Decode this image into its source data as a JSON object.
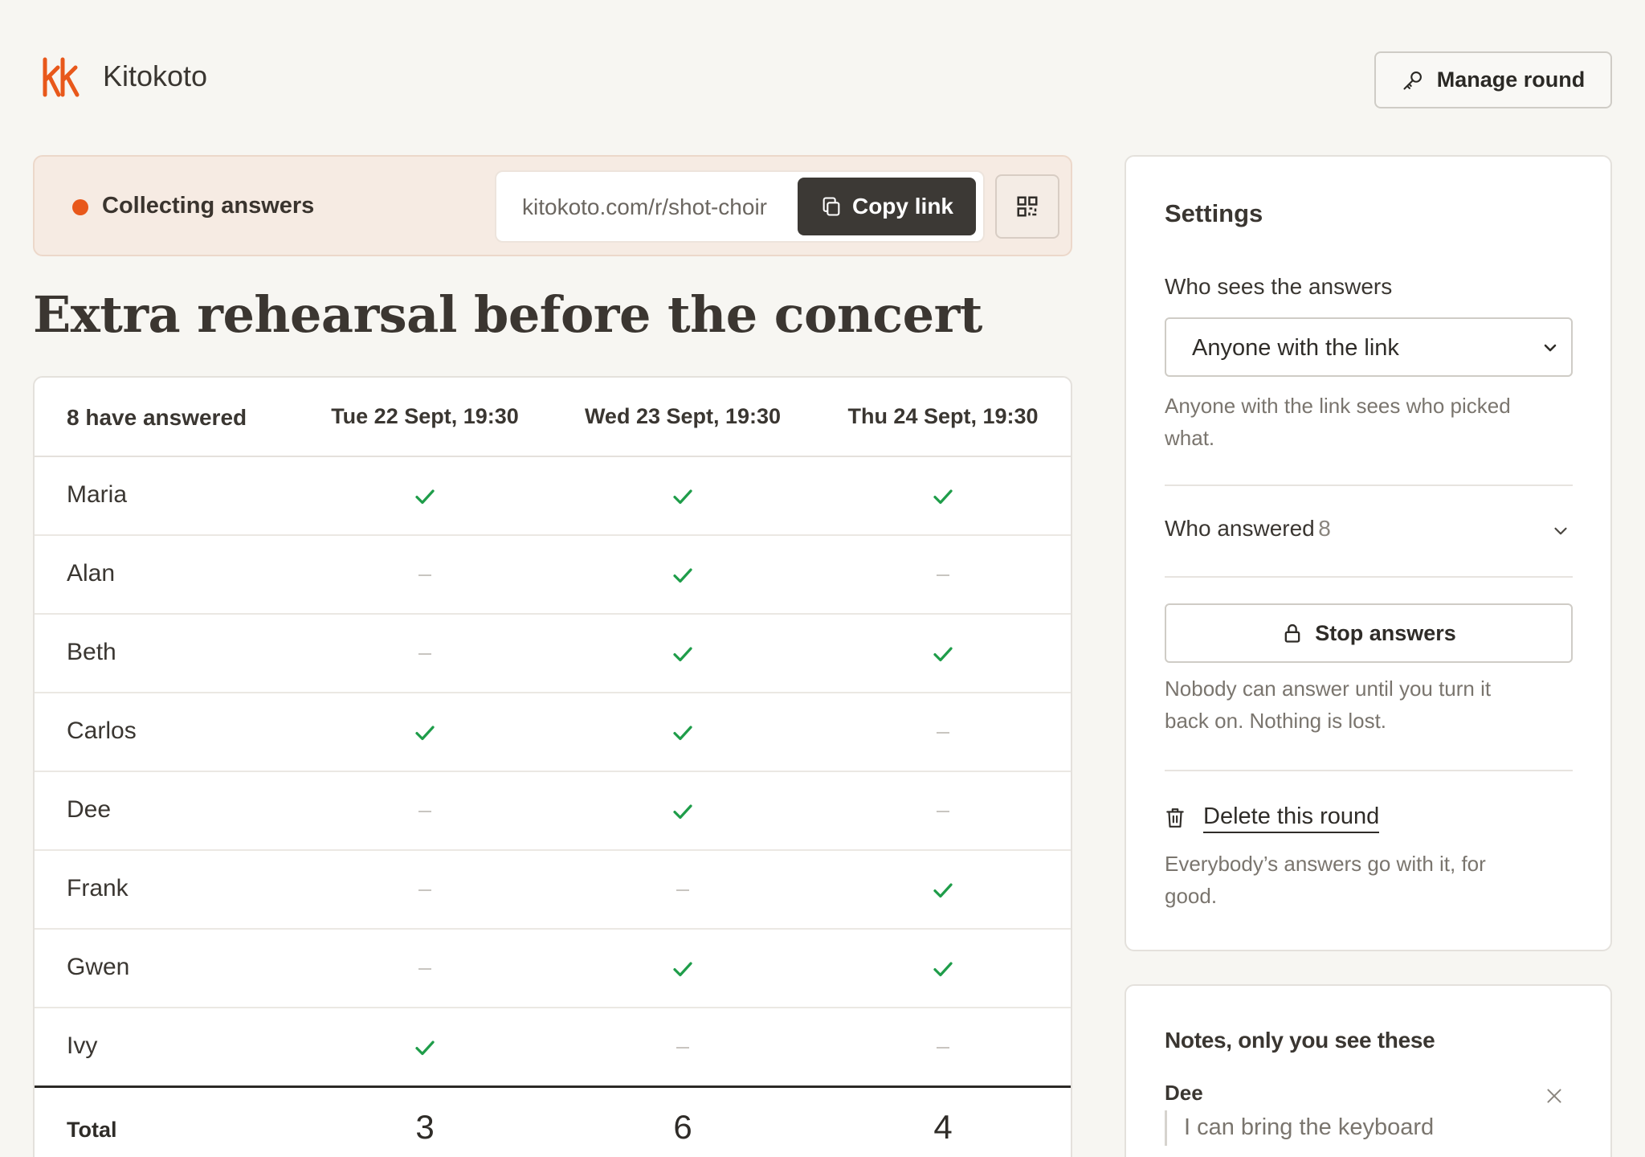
{
  "brand": {
    "name": "Kitokoto",
    "accent": "#e8581b"
  },
  "header": {
    "manage_label": "Manage round"
  },
  "status": {
    "text": "Collecting answers",
    "link": "kitokoto.com/r/shot-choir",
    "copy_label": "Copy link"
  },
  "title": "Extra rehearsal before the concert",
  "table": {
    "answered_label": "8 have answered",
    "columns": [
      "Tue 22 Sept, 19:30",
      "Wed 23 Sept, 19:30",
      "Thu 24 Sept, 19:30"
    ],
    "rows": [
      {
        "name": "Maria",
        "answers": [
          true,
          true,
          true
        ]
      },
      {
        "name": "Alan",
        "answers": [
          false,
          true,
          false
        ]
      },
      {
        "name": "Beth",
        "answers": [
          false,
          true,
          true
        ]
      },
      {
        "name": "Carlos",
        "answers": [
          true,
          true,
          false
        ]
      },
      {
        "name": "Dee",
        "answers": [
          false,
          true,
          false
        ]
      },
      {
        "name": "Frank",
        "answers": [
          false,
          false,
          true
        ]
      },
      {
        "name": "Gwen",
        "answers": [
          false,
          true,
          true
        ]
      },
      {
        "name": "Ivy",
        "answers": [
          true,
          false,
          false
        ]
      }
    ],
    "total_label": "Total",
    "totals": [
      "3",
      "6",
      "4"
    ]
  },
  "settings": {
    "title": "Settings",
    "visibility_label": "Who sees the answers",
    "visibility_value": "Anyone with the link",
    "visibility_help": "Anyone with the link sees who picked what.",
    "who_answered_label": "Who answered",
    "who_answered_count": "8",
    "stop_label": "Stop answers",
    "stop_help": "Nobody can answer until you turn it back on. Nothing is lost.",
    "delete_label": "Delete this round",
    "delete_help": "Everybody’s answers go with it, for good."
  },
  "notes": {
    "title": "Notes, only you see these",
    "items": [
      {
        "name": "Dee",
        "text": "I can bring the keyboard"
      }
    ]
  },
  "colors": {
    "check": "#1f9d4a",
    "dark_button": "#3c3935",
    "status_bg": "#f6ebe3"
  }
}
